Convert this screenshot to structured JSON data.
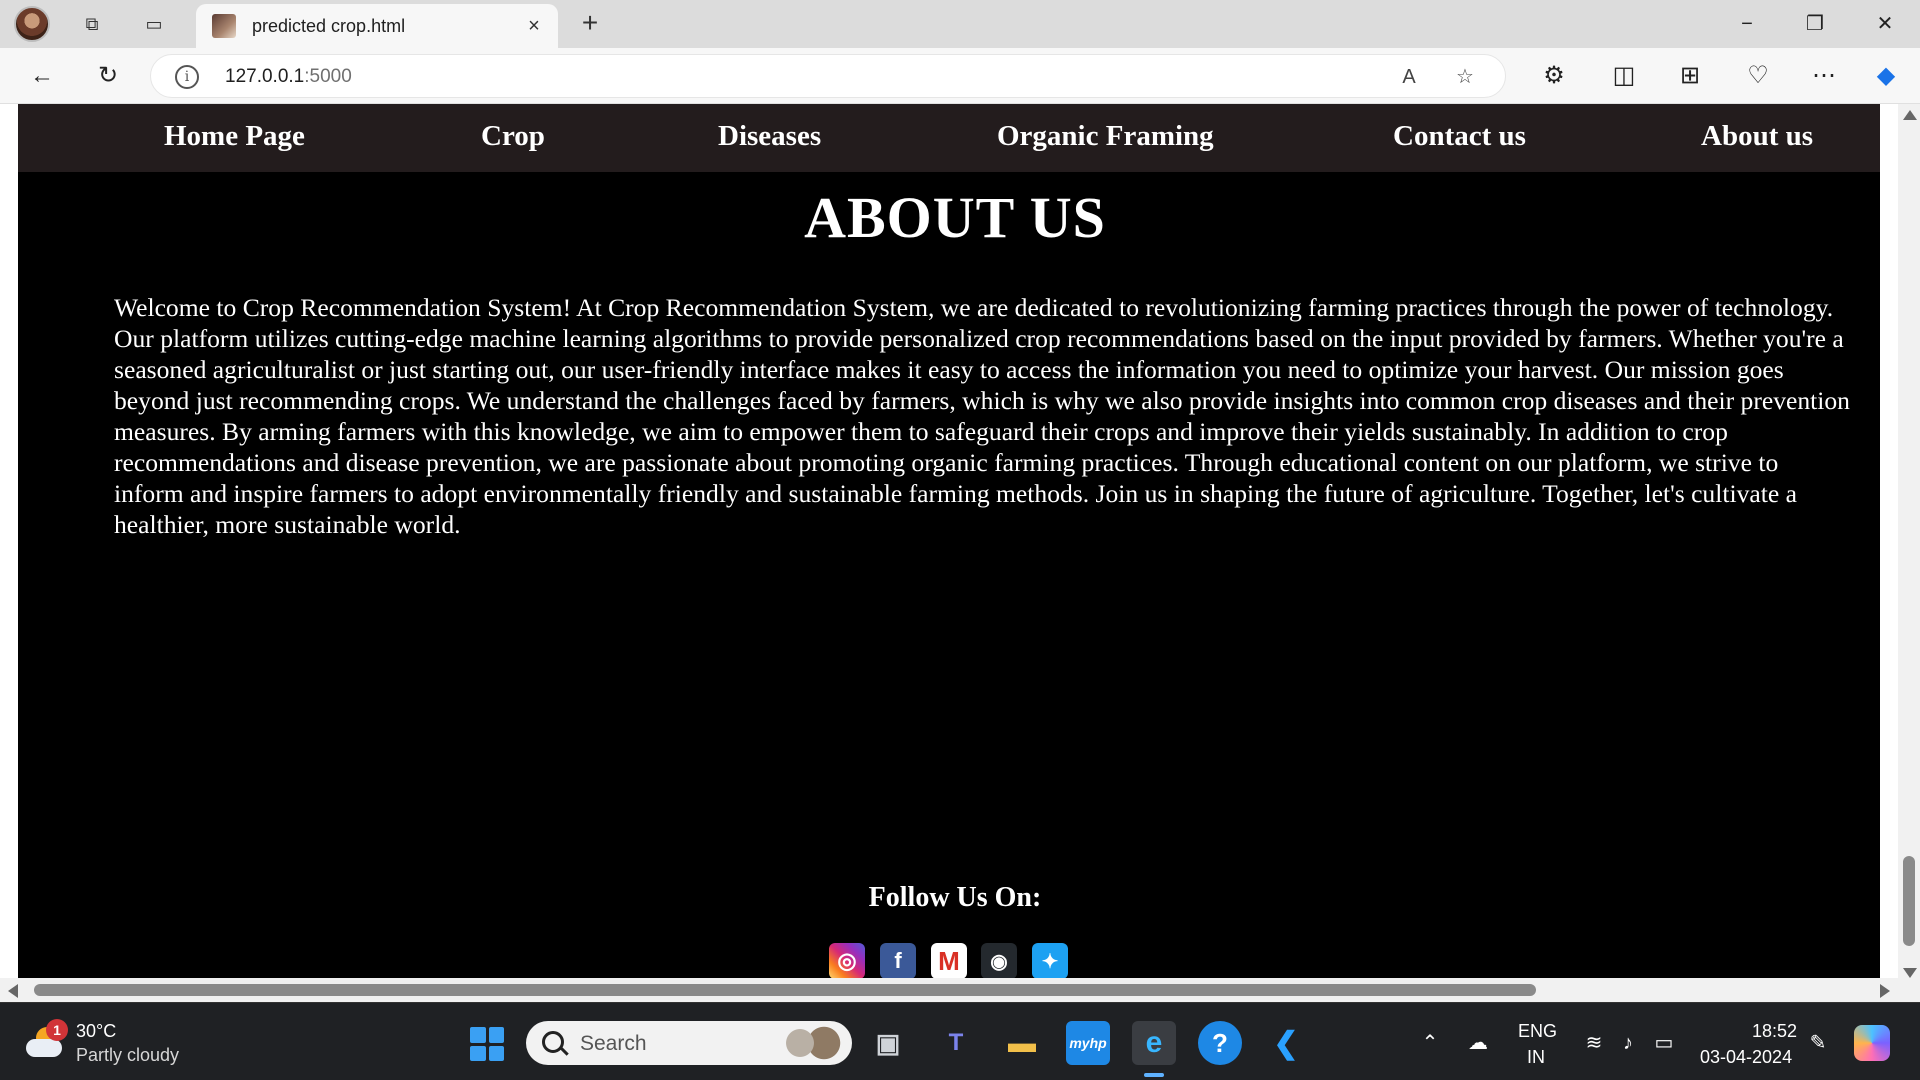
{
  "browser": {
    "tab_title": "predicted crop.html",
    "url_host": "127.0.0.1",
    "url_port": ":5000",
    "close_tab": "×",
    "new_tab": "+"
  },
  "site": {
    "nav": [
      "Home Page",
      "Crop",
      "Diseases",
      "Organic Framing",
      "Contact us",
      "About us"
    ],
    "title": "ABOUT US",
    "body": "Welcome to Crop Recommendation System! At Crop Recommendation System, we are dedicated to revolutionizing farming practices through the power of technology. Our platform utilizes cutting-edge machine learning algorithms to provide personalized crop recommendations based on the input provided by farmers. Whether you're a seasoned agriculturalist or just starting out, our user-friendly interface makes it easy to access the information you need to optimize your harvest. Our mission goes beyond just recommending crops. We understand the challenges faced by farmers, which is why we also provide insights into common crop diseases and their prevention measures. By arming farmers with this knowledge, we aim to empower them to safeguard their crops and improve their yields sustainably. In addition to crop recommendations and disease prevention, we are passionate about promoting organic farming practices. Through educational content on our platform, we strive to inform and inspire farmers to adopt environmentally friendly and sustainable farming methods. Join us in shaping the future of agriculture. Together, let's cultivate a healthier, more sustainable world.",
    "follow_label": "Follow Us On:",
    "social_icons": [
      "instagram-icon",
      "facebook-icon",
      "gmail-icon",
      "github-icon",
      "twitter-icon"
    ],
    "colors": {
      "nav_bg": "#231c1d",
      "page_bg": "#000000",
      "text": "#ffffff"
    }
  },
  "taskbar": {
    "weather_badge": "1",
    "temperature": "30°C",
    "weather_desc": "Partly cloudy",
    "search_label": "Search",
    "lang_line1": "ENG",
    "lang_line2": "IN",
    "time": "18:52",
    "date": "03-04-2024"
  }
}
